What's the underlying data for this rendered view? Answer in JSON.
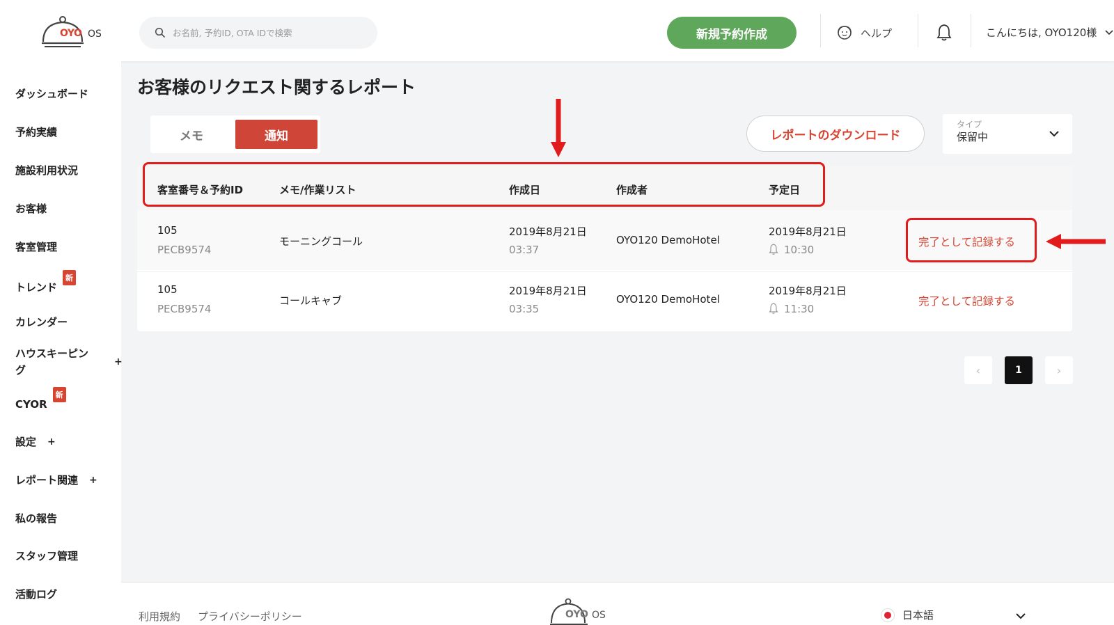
{
  "header": {
    "logo_text": "OYO",
    "logo_suffix": "OS",
    "search_placeholder": "お名前, 予約ID, OTA IDで検索",
    "new_booking_label": "新規予約作成",
    "help_label": "ヘルプ",
    "greeting": "こんにちは, OYO120様"
  },
  "sidebar": {
    "items": [
      {
        "label": "ダッシュボード"
      },
      {
        "label": "予約実績"
      },
      {
        "label": "施設利用状況"
      },
      {
        "label": "お客様"
      },
      {
        "label": "客室管理"
      },
      {
        "label": "トレンド",
        "badge": "新"
      },
      {
        "label": "カレンダー"
      },
      {
        "label": "ハウスキーピン\nグ",
        "expand": "+"
      },
      {
        "label": "CYOR",
        "badge": "新"
      },
      {
        "label": "設定",
        "expand": "+"
      },
      {
        "label": "レポート関連",
        "expand": "+"
      },
      {
        "label": "私の報告"
      },
      {
        "label": "スタッフ管理"
      },
      {
        "label": "活動ログ"
      }
    ]
  },
  "main": {
    "title": "お客様のリクエスト関するレポート",
    "tabs": [
      {
        "label": "メモ",
        "active": false
      },
      {
        "label": "通知",
        "active": true
      }
    ],
    "download_label": "レポートのダウンロード",
    "type_filter": {
      "label": "タイプ",
      "value": "保留中"
    },
    "table": {
      "headers": [
        "客室番号＆予約ID",
        "メモ/作業リスト",
        "作成日",
        "作成者",
        "予定日"
      ],
      "rows": [
        {
          "room": "105",
          "booking_id": "PECB9574",
          "task": "モーニングコール",
          "created_date": "2019年8月21日",
          "created_time": "03:37",
          "creator": "OYO120 DemoHotel",
          "scheduled_date": "2019年8月21日",
          "scheduled_time": "10:30",
          "action": "完了として記録する"
        },
        {
          "room": "105",
          "booking_id": "PECB9574",
          "task": "コールキャブ",
          "created_date": "2019年8月21日",
          "created_time": "03:35",
          "creator": "OYO120 DemoHotel",
          "scheduled_date": "2019年8月21日",
          "scheduled_time": "11:30",
          "action": "完了として記録する"
        }
      ]
    },
    "pagination": {
      "prev": "‹",
      "current": "1",
      "next": "›"
    }
  },
  "footer": {
    "terms": "利用規約",
    "privacy": "プライバシーポリシー",
    "language": "日本語"
  },
  "colors": {
    "accent": "#d84432",
    "primary_green": "#5fa75a",
    "annotation_red": "#e11c1c"
  }
}
